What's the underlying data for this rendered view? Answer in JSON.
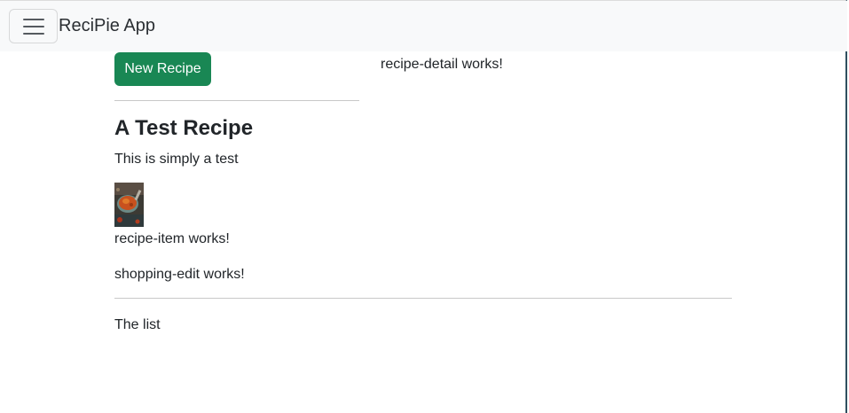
{
  "navbar": {
    "brand": "ReciPie App",
    "toggle_icon": "hamburger-menu-icon"
  },
  "recipes": {
    "new_button_label": "New Recipe",
    "items": [
      {
        "name": "A Test Recipe",
        "description": "This is simply a test",
        "image": "recipe-thumbnail"
      }
    ],
    "item_component_text": "recipe-item works!"
  },
  "recipe_detail": {
    "text": "recipe-detail works!"
  },
  "shopping": {
    "edit_text": "shopping-edit works!",
    "list_text": "The list"
  },
  "colors": {
    "navbar_bg": "#f8f9fa",
    "button_green": "#198754",
    "text": "#212529",
    "divider": "#c8c8c8"
  }
}
